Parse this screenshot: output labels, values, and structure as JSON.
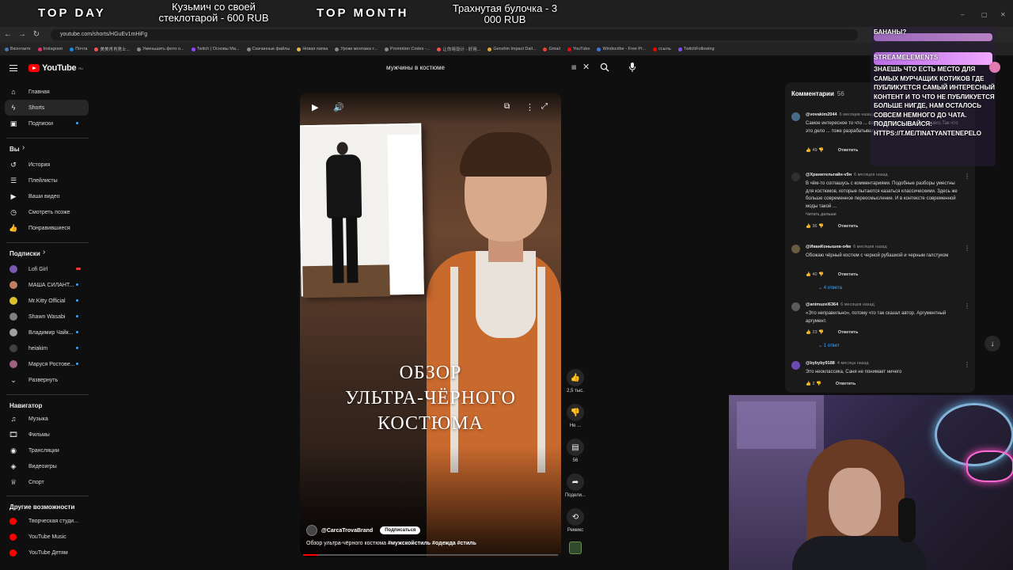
{
  "overlay": {
    "top_day_label": "TOP DAY",
    "top_day_item": "Кузьмич со своей стеклотарой - 600 RUB",
    "top_month_label": "TOP MONTH",
    "top_month_item": "Трахнутая булочка - 3 000 RUB"
  },
  "browser": {
    "url": "youtube.com/shorts/HGuEv1mHiFg",
    "bookmarks": [
      {
        "label": "Вконтакте",
        "color": "#4a76a8"
      },
      {
        "label": "Instagram",
        "color": "#e1306c"
      },
      {
        "label": "Почта",
        "color": "#168de2"
      },
      {
        "label": "美美肖肖男士...",
        "color": "#ff4f4f"
      },
      {
        "label": "Уменьшить фото о...",
        "color": "#888888"
      },
      {
        "label": "Twitch | Основы Ма...",
        "color": "#9146ff"
      },
      {
        "label": "Скачанные файлы",
        "color": "#888888"
      },
      {
        "label": "Новая папка",
        "color": "#e8b84a"
      },
      {
        "label": "Уроки монтажа т...",
        "color": "#888888"
      },
      {
        "label": "Promotion Codes -...",
        "color": "#888888"
      },
      {
        "label": "让你用设计 - 好用...",
        "color": "#ff4f4f"
      },
      {
        "label": "Genshin Impact Dail...",
        "color": "#d9a441"
      },
      {
        "label": "Gmail",
        "color": "#ea4335"
      },
      {
        "label": "YouTube",
        "color": "#ff0000"
      },
      {
        "label": "Windscribe - Free Pr...",
        "color": "#3a7bd5"
      },
      {
        "label": "ссыль",
        "color": "#ff0000"
      },
      {
        "label": "TwitchFollowing",
        "color": "#9146ff"
      }
    ]
  },
  "header": {
    "logo_text": "YouTube",
    "logo_region": "RU",
    "search_value": "мужчины в костюме"
  },
  "sidebar": {
    "main": [
      {
        "label": "Главная",
        "icon": "home-icon",
        "glyph": "⌂"
      },
      {
        "label": "Shorts",
        "icon": "shorts-icon",
        "glyph": "ϟ"
      },
      {
        "label": "Подписки",
        "icon": "subscriptions-icon",
        "glyph": "▣"
      }
    ],
    "you_heading": "Вы",
    "you": [
      {
        "label": "История",
        "icon": "history-icon",
        "glyph": "↺"
      },
      {
        "label": "Плейлисты",
        "icon": "playlists-icon",
        "glyph": "☰"
      },
      {
        "label": "Ваши видео",
        "icon": "your-videos-icon",
        "glyph": "▶"
      },
      {
        "label": "Смотреть позже",
        "icon": "watch-later-icon",
        "glyph": "◷"
      },
      {
        "label": "Понравившиеся",
        "icon": "liked-icon",
        "glyph": "👍"
      }
    ],
    "subs_heading": "Подписки",
    "subs": [
      {
        "label": "Lofi Girl",
        "color": "#7a5ab0"
      },
      {
        "label": "МАША СИЛАНТ...",
        "color": "#c08060"
      },
      {
        "label": "Mr.Kitty Official",
        "color": "#d9c030"
      },
      {
        "label": "Shawn Wasabi",
        "color": "#808080"
      },
      {
        "label": "Владимир Чайк...",
        "color": "#a0a0a0"
      },
      {
        "label": "heiakim",
        "color": "#404040"
      },
      {
        "label": "Маруся Ростове...",
        "color": "#a06080"
      }
    ],
    "expand_label": "Развернуть",
    "nav_heading": "Навигатор",
    "nav": [
      {
        "label": "Музыка",
        "icon": "music-icon",
        "glyph": "♫"
      },
      {
        "label": "Фильмы",
        "icon": "movies-icon",
        "glyph": "🎞"
      },
      {
        "label": "Трансляции",
        "icon": "live-icon",
        "glyph": "◉"
      },
      {
        "label": "Видеоигры",
        "icon": "gaming-icon",
        "glyph": "◈"
      },
      {
        "label": "Спорт",
        "icon": "sport-icon",
        "glyph": "♕"
      }
    ],
    "more_heading": "Другие возможности",
    "more": [
      {
        "label": "Творческая студи...",
        "icon": "studio-icon"
      },
      {
        "label": "YouTube Music",
        "icon": "yt-music-icon"
      },
      {
        "label": "YouTube Детям",
        "icon": "yt-kids-icon"
      }
    ]
  },
  "short": {
    "overlay_title": "ОБЗОР\nУЛЬТРА-ЧЁРНОГО\nКОСТЮМА",
    "channel": "@CarcaTrovaBrand",
    "subscribe": "Подписаться",
    "caption": "Обзор ультра-чёрного костюма #мужскойстиль #одежда #стиль",
    "progress": 0.06
  },
  "actions": {
    "likes": "2,5 тыс.",
    "dislike": "Не ...",
    "comments": "56",
    "share": "Подели...",
    "remix": "Ремикс"
  },
  "comments": {
    "title": "Комментарии",
    "count": "56",
    "items": [
      {
        "user": "@vovakim2044",
        "time": "6 месяцев назад",
        "text": "Самое интересное то что ... совершенно с вами не ... вашего.Так что это дело ... тоже разрабатывал,совет...",
        "likes": "49",
        "reply": "Ответить",
        "replies": "",
        "avatar": "#4a6a8a"
      },
      {
        "user": "@Хранительтайн-v9н",
        "time": "6 месяцев назад",
        "text": "В чём-то соглашусь с комментариями. Подобные разборы уместны для костюмов, которые пытаются казаться классическими. Здесь же больше современное переосмысление. И в контексте современной моды такой ...",
        "more": "Читать дальше",
        "likes": "36",
        "reply": "Ответить",
        "replies": "",
        "avatar": "#303030"
      },
      {
        "user": "@ИванКонышев-о4м",
        "time": "6 месяцев назад",
        "text": "Обожаю чёрный костюм с черной рубашкой и черным галстуком",
        "likes": "40",
        "reply": "Ответить",
        "replies": "4 ответа",
        "avatar": "#6a5a40"
      },
      {
        "user": "@animuzel6364",
        "time": "6 месяцев назад",
        "text": "«Это неправильно», потому что так сказал автор. Аргументный аргумент.",
        "likes": "23",
        "reply": "Ответить",
        "replies": "1 ответ",
        "avatar": "#5a5a5a"
      },
      {
        "user": "@bybyby9188",
        "time": "4 месяца назад",
        "text": "Это неоклассика, Саня не понимает ничего",
        "likes": "2",
        "reply": "Ответить",
        "replies": "",
        "avatar": "#6a4ab0"
      }
    ]
  },
  "stream_elements": {
    "prev_text": "БАНАНЫ?",
    "name": "STREAMELEMENTS",
    "message": "ЗНАЕШЬ ЧТО ЕСТЬ МЕСТО ДЛЯ САМЫХ МУРЧАЩИХ КОТИКОВ ГДЕ ПУБЛИКУЕТСЯ САМЫЙ ИНТЕРЕСНЫЙ КОНТЕНТ И ТО ЧТО НЕ ПУБЛИКУЕТСЯ БОЛЬШЕ НИГДЕ, НАМ ОСТАЛОСЬ СОВСЕМ НЕМНОГО ДО ЧАТА. ПОДПИСЫВАЙСЯ: HTTPS://T.ME/TINATYANTENEPELO"
  }
}
